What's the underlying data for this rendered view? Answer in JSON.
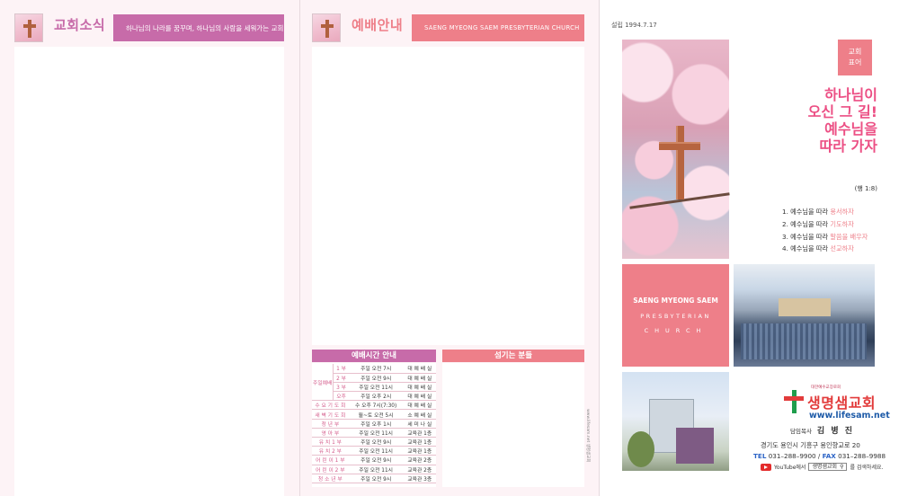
{
  "page1": {
    "title": "교회소식",
    "bar_text": "하나님의 나라를 꿈꾸며, 하나님의 사람을 세워가는 교회"
  },
  "page2": {
    "title": "예배안내",
    "bar_text": "SAENG MYEONG SAEM PRESBYTERIAN CHURCH",
    "schedule_title": "예배시간 안내",
    "serve_title": "섬기는 분들",
    "vertical_note": "www.lifesam.net 생명샘교회",
    "schedule": [
      {
        "group": "주일예배",
        "name": "1 부",
        "time": "주일 오전 7시",
        "place": "대 예 배 실"
      },
      {
        "group": "",
        "name": "2 부",
        "time": "주일 오전 9시",
        "place": "대 예 배 실"
      },
      {
        "group": "",
        "name": "3 부",
        "time": "주일 오전 11시",
        "place": "대 예 배 실"
      },
      {
        "group": "",
        "name": "오후",
        "time": "주일 오후 2시",
        "place": "대 예 배 실"
      },
      {
        "group": "",
        "name": "수 요 기 도 회",
        "time": "수 오후 7시(7:30)",
        "place": "대 예 배 실"
      },
      {
        "group": "",
        "name": "새 벽 기 도 회",
        "time": "월~토 오전 5시",
        "place": "소 예 배 실"
      },
      {
        "group": "",
        "name": "청 년 부",
        "time": "주일 오후 1시",
        "place": "세 미 나 실"
      },
      {
        "group": "",
        "name": "영 아 부",
        "time": "주일 오전 11시",
        "place": "교육관 1층"
      },
      {
        "group": "",
        "name": "유 치 1 부",
        "time": "주일 오전 9시",
        "place": "교육관 1층"
      },
      {
        "group": "",
        "name": "유 치 2 부",
        "time": "주일 오전 11시",
        "place": "교육관 1층"
      },
      {
        "group": "",
        "name": "어 린 이 1 부",
        "time": "주일 오전 9시",
        "place": "교육관 2층"
      },
      {
        "group": "",
        "name": "어 린 이 2 부",
        "time": "주일 오전 11시",
        "place": "교육관 2층"
      },
      {
        "group": "",
        "name": "청 소 년 부",
        "time": "주일 오전 9시",
        "place": "교육관 3층"
      }
    ]
  },
  "cover": {
    "established": "설립 1994.7.17",
    "motto_tag_line1": "교회",
    "motto_tag_line2": "표어",
    "motto_lines": [
      "하나님이",
      "오신 그 길!",
      "예수님을",
      "따라 가자"
    ],
    "verse": "(행 1:8)",
    "rules": [
      {
        "prefix": "1. 예수님을 따라 ",
        "highlight": "용서하자"
      },
      {
        "prefix": "2. 예수님을 따라 ",
        "highlight": "기도하자"
      },
      {
        "prefix": "3. 예수님을 따라 ",
        "highlight": "말씀을 배우자"
      },
      {
        "prefix": "4. 예수님을 따라 ",
        "highlight": "선교하자"
      }
    ],
    "eng_line1": "SAENG MYEONG SAEM",
    "eng_line2": "PRESBYTERIAN",
    "eng_line3": "CHURCH",
    "logo_small": "대한예수교장로회",
    "logo_name": "생명샘교회",
    "logo_url": "www.lifesam.net",
    "pastor_label": "담임목사",
    "pastor_name": "김 병 진",
    "address": "경기도 용인시 기흥구 용인향교로 20",
    "tel_label": "TEL",
    "tel": "031–288–9900",
    "fax_label": "FAX",
    "fax": "031–288–9988",
    "yt_text": "YouTube에서",
    "search_term": "생명샘교회",
    "search_suffix": "를 검색하세요."
  },
  "colors": {
    "pink": "#c76ba9",
    "coral": "#ee7f89",
    "magenta": "#ec4f84"
  }
}
